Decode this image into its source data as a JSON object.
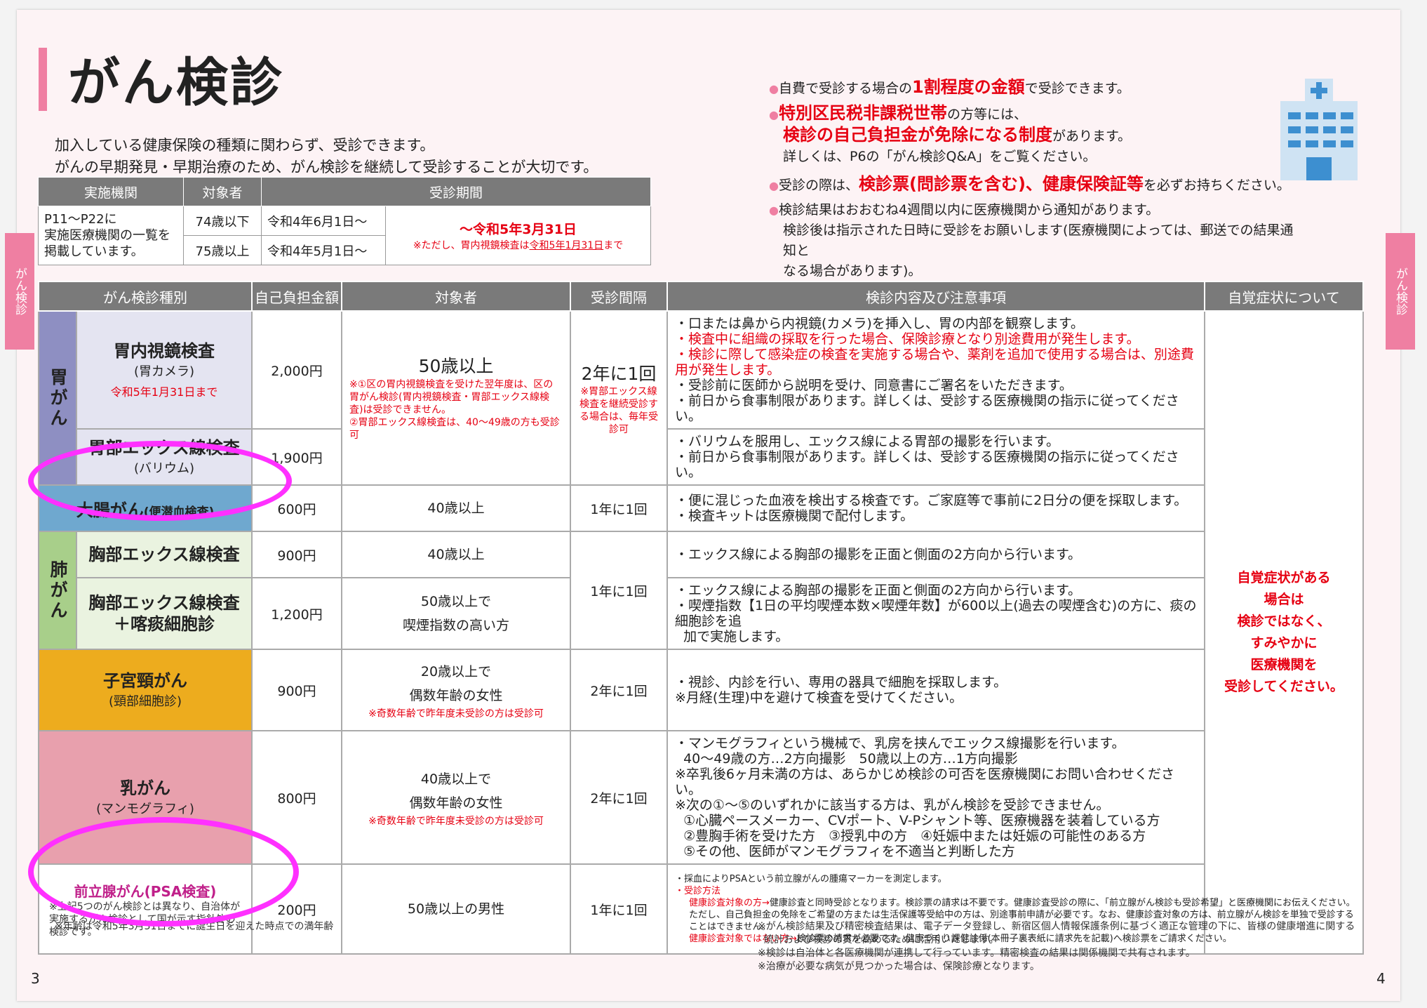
{
  "title": "がん検診",
  "intro": [
    "加入している健康保険の種類に関わらず、受診できます。",
    "がんの早期発見・早期治療のため、がん検診を継続して受診することが大切です。"
  ],
  "schedule": {
    "headers": [
      "実施機関",
      "対象者",
      "受診期間"
    ],
    "institution": [
      "P11～P22に",
      "実施医療機関の一覧を",
      "掲載しています。"
    ],
    "row1_target": "74歳以下",
    "row1_start": "令和4年6月1日～",
    "row2_target": "75歳以上",
    "row2_start": "令和4年5月1日～",
    "end": "～令和5年3月31日",
    "end_note_pre": "※ただし、胃内視鏡検査は",
    "end_note_date": "令和5年1月31日",
    "end_note_post": "まで"
  },
  "bullets": {
    "b1_pre": "自費で受診する場合の",
    "b1_em": "1割程度の金額",
    "b1_post": "で受診できます。",
    "b2_em": "特別区民税非課税世帯",
    "b2_post": "の方等には、",
    "b2_em2": "検診の自己負担金が免除になる制度",
    "b2_post2": "があります。",
    "b2_line3": "詳しくは、P6の「がん検診Q&A」をご覧ください。",
    "b3_pre": "受診の際は、",
    "b3_em": "検診票(問診票を含む)、健康保険証等",
    "b3_post": "を必ずお持ちください。",
    "b4_line1": "検診結果はおおむね4週間以内に医療機関から通知があります。",
    "b4_line2": "検診後は指示された日時に受診をお願いします(医療機関によっては、郵送での結果通知と",
    "b4_line3": "なる場合があります)。"
  },
  "side_tab_left": "がん検診",
  "side_tab_right": "がん検診",
  "table": {
    "headers": [
      "がん検診種別",
      "自己負担金額",
      "対象者",
      "受診間隔",
      "検診内容及び注意事項",
      "自覚症状について"
    ],
    "stomach_group": "胃がん",
    "lung_group": "肺がん",
    "endoscopy": {
      "name": "胃内視鏡検査",
      "sub": "(胃カメラ)",
      "deadline": "令和5年1月31日まで",
      "price": "2,000円",
      "details": [
        "・口または鼻から内視鏡(カメラ)を挿入し、胃の内部を観察します。",
        "・検査中に組織の採取を行った場合、保険診療となり別途費用が発生します。",
        "・検診に際して感染症の検査を実施する場合や、薬剤を追加で使用する場合は、別途費用が発生します。",
        "・受診前に医師から説明を受け、同意書にご署名をいただきます。",
        "・前日から食事制限があります。詳しくは、受診する医療機関の指示に従ってください。"
      ]
    },
    "stomach_target": "50歳以上",
    "stomach_target_note1": "※①区の胃内視鏡検査を受けた翌年度は、区の胃がん検診(胃内視鏡検査・胃部エックス線検査)は受診できません。",
    "stomach_target_note2": "②胃部エックス線検査は、40～49歳の方も受診可",
    "stomach_interval": "2年に1回",
    "stomach_interval_note": "※胃部エックス線検査を継続受診する場合は、毎年受診可",
    "xray": {
      "name": "胃部エックス線検査",
      "sub": "(バリウム)",
      "price": "1,900円",
      "details": [
        "・バリウムを服用し、エックス線による胃部の撮影を行います。",
        "・前日から食事制限があります。詳しくは、受診する医療機関の指示に従ってください。"
      ]
    },
    "colon": {
      "name": "大腸がん",
      "sub": "(便潜血検査)",
      "price": "600円",
      "target": "40歳以上",
      "interval": "1年に1回",
      "details": [
        "・便に混じった血液を検出する検査です。ご家庭等で事前に2日分の便を採取します。",
        "・検査キットは医療機関で配付します。"
      ]
    },
    "lung1": {
      "name": "胸部エックス線検査",
      "price": "900円",
      "target": "40歳以上",
      "details": [
        "・エックス線による胸部の撮影を正面と側面の2方向から行います。"
      ]
    },
    "lung_interval": "1年に1回",
    "lung2": {
      "name1": "胸部エックス線検査",
      "name2": "＋喀痰細胞診",
      "price": "1,200円",
      "target1": "50歳以上で",
      "target2": "喫煙指数の高い方",
      "details": [
        "・エックス線による胸部の撮影を正面と側面の2方向から行います。",
        "・喫煙指数【1日の平均喫煙本数×喫煙年数】が600以上(過去の喫煙含む)の方に、痰の細胞診を追",
        "  加で実施します。"
      ]
    },
    "cervical": {
      "name": "子宮頸がん",
      "sub": "(頸部細胞診)",
      "price": "900円",
      "target1": "20歳以上で",
      "target2": "偶数年齢の女性",
      "note": "※奇数年齢で昨年度未受診の方は受診可",
      "interval": "2年に1回",
      "details": [
        "・視診、内診を行い、専用の器具で細胞を採取します。",
        "※月経(生理)中を避けて検査を受けてください。"
      ]
    },
    "breast": {
      "name": "乳がん",
      "sub": "(マンモグラフィ)",
      "price": "800円",
      "target1": "40歳以上で",
      "target2": "偶数年齢の女性",
      "note": "※奇数年齢で昨年度未受診の方は受診可",
      "interval": "2年に1回",
      "details": [
        "・マンモグラフィという機械で、乳房を挟んでエックス線撮影を行います。",
        "  40～49歳の方…2方向撮影　50歳以上の方…1方向撮影",
        "※卒乳後6ヶ月未満の方は、あらかじめ検診の可否を医療機関にお問い合わせください。",
        "※次の①～⑤のいずれかに該当する方は、乳がん検診を受診できません。",
        "  ①心臓ペースメーカー、CVポート、V-Pシャント等、医療機器を装着している方",
        "  ②豊胸手術を受けた方　③授乳中の方　④妊娠中または妊娠の可能性のある方",
        "  ⑤その他、医師がマンモグラフィを不適当と判断した方"
      ]
    },
    "prostate": {
      "name": "前立腺がん(PSA検査)",
      "note": "※上記5つのがん検診とは異なり、自治体が実施するがん検診として国が示す指針外の検診です。",
      "price": "200円",
      "target": "50歳以上の男性",
      "interval": "1年に1回",
      "det1": "・採血によりPSAという前立腺がんの腫瘍マーカーを測定します。",
      "det2": "・受診方法",
      "det3_label": "健康診査対象の方→",
      "det3": "健康診査と同時受診となります。検診票の請求は不要です。健康診査受診の際に、「前立腺がん検診も受診希望」と医療機関にお伝えください。ただし、自己負担金の免除をご希望の方または生活保護等受給中の方は、別途事前申請が必要です。なお、健康診査対象の方は、前立腺がん検診を単独で受診することはできません。",
      "det4_label": "健康診査対象ではない方→",
      "det4": "検診票の請求が必要です。健康づくり課健診係(本冊子裏表紙に請求先を記載)へ検診票をご請求ください。"
    },
    "symptoms": [
      "自覚症状がある",
      "場合は",
      "検診ではなく、",
      "すみやかに",
      "医療機関を",
      "受診してください。"
    ]
  },
  "footnote_left": "※年齢は令和5年3月31日までに誕生日を迎えた時点での満年齢",
  "footnotes_right": [
    "※がん検診結果及び精密検査結果は、電子データ登録し、新宿区個人情報保護条例に基づく適正な管理の下に、皆様の健康増進に関する",
    "  統計および検診の質を高めるために活用いたします。",
    "※検診は自治体と各医療機関が連携して行っています。精密検査の結果は関係機関で共有されます。",
    "※治療が必要な病気が見つかった場合は、保険診療となります。"
  ],
  "page_left": "3",
  "page_right": "4",
  "colors": {
    "pink": "#ef7fa2",
    "stomach": "#8e8fc2",
    "stomach_light": "#e4e4f1",
    "colon": "#6fa8cf",
    "lung": "#a8cf8a",
    "lung_light": "#eaf3e0",
    "cervical": "#edac1e",
    "breast": "#e8a0ad",
    "highlight": "#ff30ff"
  }
}
